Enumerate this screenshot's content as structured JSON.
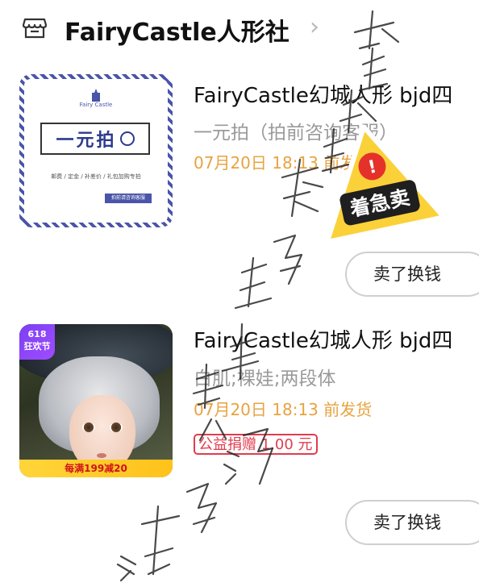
{
  "shop": {
    "name": "FairyCastle人形社",
    "icon": "store-icon",
    "chevron": "›"
  },
  "items": [
    {
      "title": "FairyCastle幻城人形 bjd四",
      "spec": "一元拍（拍前咨询客服）",
      "ship": "07月20日 18:13 前发货",
      "sell_label": "卖了换钱",
      "thumb": {
        "brand": "Fairy Castle",
        "promo": "一元拍",
        "promo_sub": "邮费 / 定金 / 补差价 / 礼包加购专拍",
        "tag": "拍前请咨询客服"
      },
      "sticker": {
        "mark": "!",
        "label": "着急卖"
      }
    },
    {
      "title": "FairyCastle幻城人形 bjd四",
      "spec": "白肌;裸娃;两段体",
      "ship": "07月20日 18:13 前发货",
      "charity": "公益捐赠 1.00 元",
      "sell_label": "卖了换钱",
      "thumb": {
        "badge_num": "618",
        "badge_label": "狂欢节",
        "coupon": "每满199减20"
      }
    }
  ],
  "watermark": "海与泥 咪羊与不羊 请勿截图 不外"
}
